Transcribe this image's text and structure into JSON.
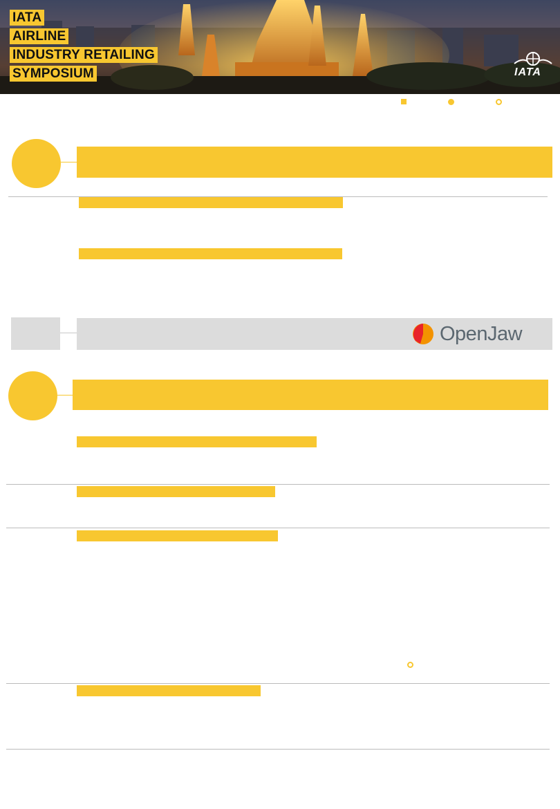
{
  "header": {
    "title_lines": [
      "IATA",
      "AIRLINE",
      "INDUSTRY RETAILING",
      "SYMPOSIUM"
    ],
    "logo_text": "IATA"
  },
  "sponsor": {
    "logo_text": "OpenJaw"
  },
  "colors": {
    "brand_yellow": "#f8c730",
    "divider_grey": "#bbbbbb",
    "sponsor_band": "#dcdcdc",
    "openjaw_red": "#e8232a",
    "openjaw_orange": "#f39200"
  },
  "icons": {
    "legend": [
      "square-marker-icon",
      "filled-dot-marker-icon",
      "ring-marker-icon"
    ],
    "banner": "iata-globe-wings-icon"
  }
}
